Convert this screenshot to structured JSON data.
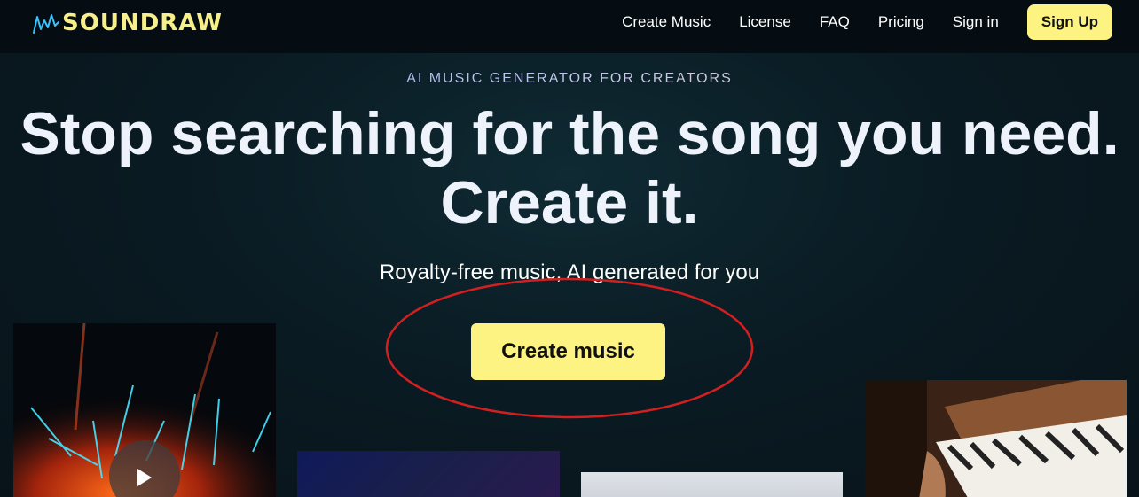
{
  "header": {
    "logo_text": "SOUNDRAW",
    "nav": [
      {
        "label": "Create Music"
      },
      {
        "label": "License"
      },
      {
        "label": "FAQ"
      },
      {
        "label": "Pricing"
      },
      {
        "label": "Sign in"
      }
    ],
    "signup_label": "Sign Up"
  },
  "hero": {
    "eyebrow": "AI MUSIC GENERATOR FOR CREATORS",
    "headline_line1": "Stop searching for the song you need.",
    "headline_line2": "Create it.",
    "subhead": "Royalty-free music, AI generated for you",
    "cta_label": "Create music"
  },
  "colors": {
    "accent": "#fdf383",
    "background": "#0b1a22",
    "annotation": "#d21f1f"
  },
  "icons": {
    "play": "play-icon",
    "logo": "sound-wave-icon"
  }
}
